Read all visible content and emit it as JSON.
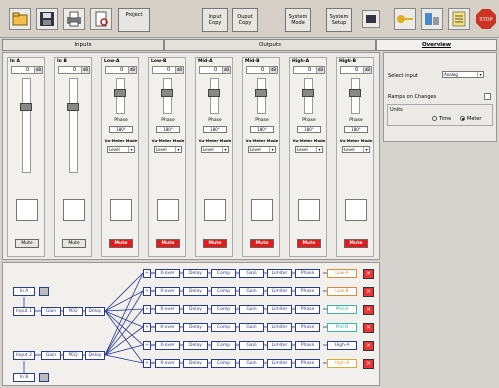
{
  "toolbar": {
    "project": "Project",
    "input_copy": "Input Copy",
    "output_copy": "Ouput Copy",
    "system_mode": "System Mode",
    "system_setup": "System Setup",
    "icons": [
      "open-folder-icon",
      "save-disk-icon",
      "print-icon",
      "print-preview-icon",
      "chip-icon",
      "key-icon",
      "connect-icon",
      "notes-icon",
      "stop-icon"
    ]
  },
  "tabs": {
    "inputs": "Inputs",
    "outputs": "Outputs",
    "overview": "Overview"
  },
  "channels": [
    {
      "name": "In A",
      "gain": "0",
      "unit": "dB",
      "type": "input",
      "mute": "Mute"
    },
    {
      "name": "In B",
      "gain": "0",
      "unit": "dB",
      "type": "input",
      "mute": "Mute"
    },
    {
      "name": "Low-A",
      "gain": "0",
      "unit": "dB",
      "type": "output",
      "phase": "Phase",
      "phase_val": "180°",
      "mode_label": "Vu-Meter Mode",
      "mode": "Level",
      "mute": "Mute"
    },
    {
      "name": "Low-B",
      "gain": "0",
      "unit": "dB",
      "type": "output",
      "phase": "Phase",
      "phase_val": "180°",
      "mode_label": "Vu-Meter Mode",
      "mode": "Level",
      "mute": "Mute"
    },
    {
      "name": "Mid-A",
      "gain": "0",
      "unit": "dB",
      "type": "output",
      "phase": "Phase",
      "phase_val": "180°",
      "mode_label": "Vu-Meter Mode",
      "mode": "Level",
      "mute": "Mute"
    },
    {
      "name": "Mid-B",
      "gain": "0",
      "unit": "dB",
      "type": "output",
      "phase": "Phase",
      "phase_val": "180°",
      "mode_label": "Vu-Meter Mode",
      "mode": "Level",
      "mute": "Mute"
    },
    {
      "name": "High-A",
      "gain": "0",
      "unit": "dB",
      "type": "output",
      "phase": "Phase",
      "phase_val": "180°",
      "mode_label": "Vu-Meter Mode",
      "mode": "Level",
      "mute": "Mute"
    },
    {
      "name": "High-B",
      "gain": "0",
      "unit": "dB",
      "type": "output",
      "phase": "Phase",
      "phase_val": "180°",
      "mode_label": "Vu-Meter Mode",
      "mode": "Level",
      "mute": "Mute"
    }
  ],
  "side": {
    "select_input_label": "Select input",
    "select_input_value": "Analog",
    "ramps_label": "Ramps on Changes",
    "units_label": "Units",
    "unit_time": "Time",
    "unit_meter": "Meter"
  },
  "routing": {
    "inA": "In A",
    "inB": "In B",
    "input1": "Input 1",
    "input2": "Input 2",
    "in_chain": [
      "Gain",
      "PEQ",
      "Delay"
    ],
    "out_chain": [
      "X-over",
      "Delay",
      "Comp",
      "Gain",
      "Limiter",
      "Phase"
    ],
    "outputs": [
      "Low-A",
      "Low-B",
      "Mid-A",
      "Mid-B",
      "High-A",
      "High-B"
    ],
    "out_colors": [
      "#d98b3a",
      "#d98b3a",
      "#3ab6a8",
      "#3ab6a8",
      "#2b3b8c",
      "#d9a93a"
    ]
  }
}
